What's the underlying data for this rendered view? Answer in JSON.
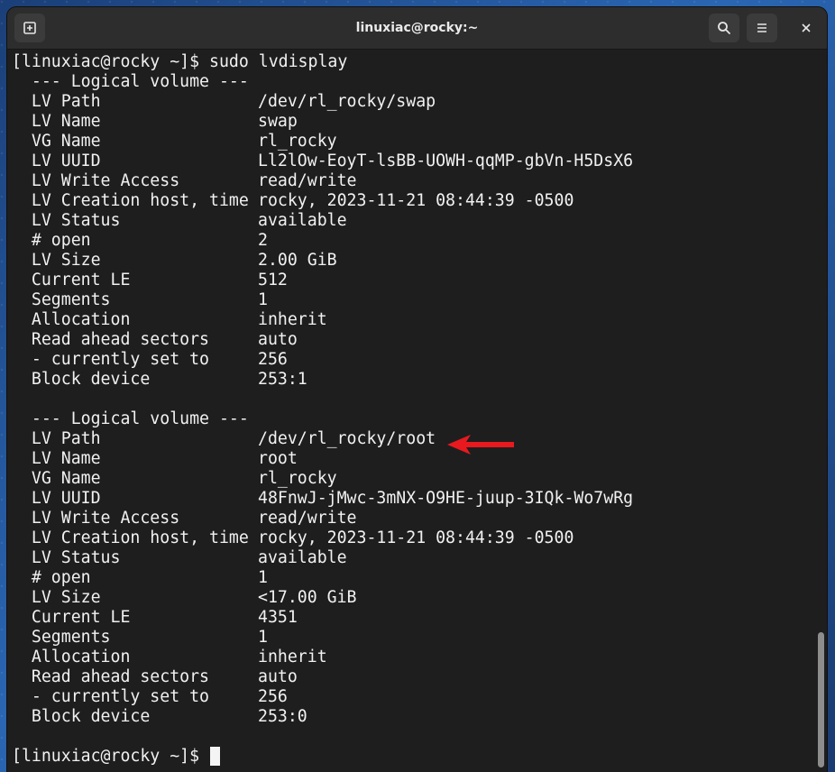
{
  "window": {
    "title": "linuxiac@rocky:~"
  },
  "icons": {
    "new_tab": "new-tab-icon",
    "search": "search-icon",
    "menu": "hamburger-menu-icon",
    "close": "close-icon",
    "annotation": "red-arrow-icon"
  },
  "colors": {
    "annotation_arrow": "#e8191f",
    "terminal_bg": "#1e1e1e",
    "terminal_fg": "#f1f1f1"
  },
  "terminal": {
    "prompt": "[linuxiac@rocky ~]$ ",
    "command": "sudo lvdisplay",
    "volumes": [
      {
        "header": "  --- Logical volume ---",
        "fields": [
          {
            "label": "  LV Path",
            "value": "/dev/rl_rocky/swap"
          },
          {
            "label": "  LV Name",
            "value": "swap"
          },
          {
            "label": "  VG Name",
            "value": "rl_rocky"
          },
          {
            "label": "  LV UUID",
            "value": "Ll2lOw-EoyT-lsBB-UOWH-qqMP-gbVn-H5DsX6"
          },
          {
            "label": "  LV Write Access",
            "value": "read/write"
          },
          {
            "label": "  LV Creation host, time",
            "value": "rocky, 2023-11-21 08:44:39 -0500"
          },
          {
            "label": "  LV Status",
            "value": "available"
          },
          {
            "label": "  # open",
            "value": "2"
          },
          {
            "label": "  LV Size",
            "value": "2.00 GiB"
          },
          {
            "label": "  Current LE",
            "value": "512"
          },
          {
            "label": "  Segments",
            "value": "1"
          },
          {
            "label": "  Allocation",
            "value": "inherit"
          },
          {
            "label": "  Read ahead sectors",
            "value": "auto"
          },
          {
            "label": "  - currently set to",
            "value": "256"
          },
          {
            "label": "  Block device",
            "value": "253:1"
          }
        ]
      },
      {
        "header": "  --- Logical volume ---",
        "fields": [
          {
            "label": "  LV Path",
            "value": "/dev/rl_rocky/root"
          },
          {
            "label": "  LV Name",
            "value": "root"
          },
          {
            "label": "  VG Name",
            "value": "rl_rocky"
          },
          {
            "label": "  LV UUID",
            "value": "48FnwJ-jMwc-3mNX-O9HE-juup-3IQk-Wo7wRg"
          },
          {
            "label": "  LV Write Access",
            "value": "read/write"
          },
          {
            "label": "  LV Creation host, time",
            "value": "rocky, 2023-11-21 08:44:39 -0500"
          },
          {
            "label": "  LV Status",
            "value": "available"
          },
          {
            "label": "  # open",
            "value": "1"
          },
          {
            "label": "  LV Size",
            "value": "<17.00 GiB"
          },
          {
            "label": "  Current LE",
            "value": "4351"
          },
          {
            "label": "  Segments",
            "value": "1"
          },
          {
            "label": "  Allocation",
            "value": "inherit"
          },
          {
            "label": "  Read ahead sectors",
            "value": "auto"
          },
          {
            "label": "  - currently set to",
            "value": "256"
          },
          {
            "label": "  Block device",
            "value": "253:0"
          }
        ]
      }
    ]
  }
}
